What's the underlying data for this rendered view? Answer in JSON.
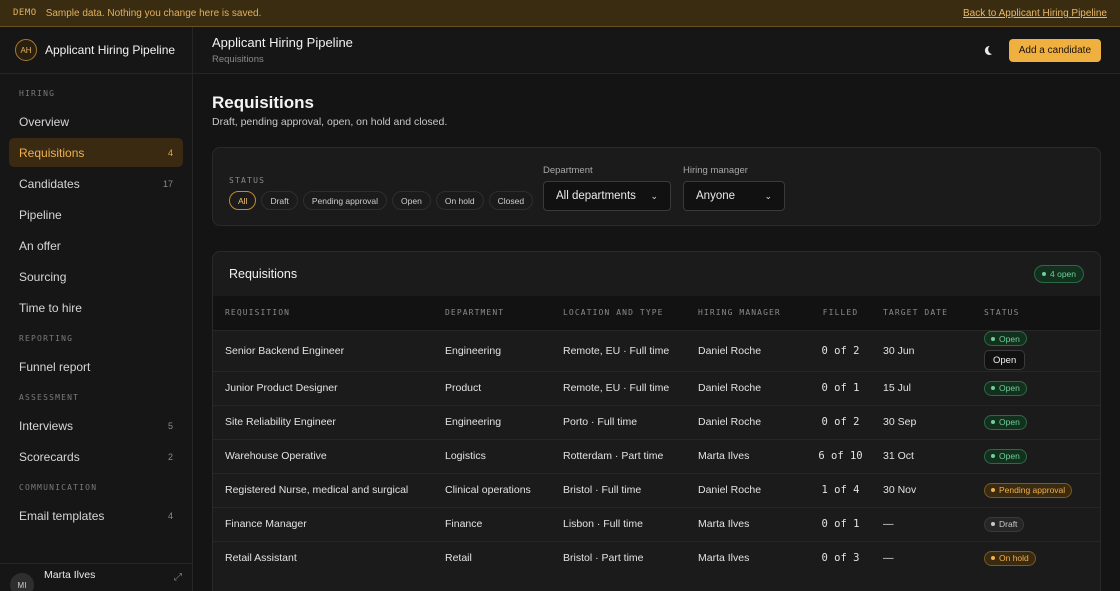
{
  "demo_banner": {
    "tag": "DEMO",
    "message": "Sample data. Nothing you change here is saved.",
    "link": "Back to Applicant Hiring Pipeline"
  },
  "brand": {
    "initials": "AH",
    "title": "Applicant Hiring Pipeline"
  },
  "sidebar": {
    "sections": [
      {
        "heading": "HIRING",
        "items": [
          {
            "label": "Overview",
            "count": ""
          },
          {
            "label": "Requisitions",
            "count": "4",
            "active": true
          },
          {
            "label": "Candidates",
            "count": "17"
          },
          {
            "label": "Pipeline",
            "count": ""
          },
          {
            "label": "An offer",
            "count": ""
          },
          {
            "label": "Sourcing",
            "count": ""
          },
          {
            "label": "Time to hire",
            "count": ""
          }
        ]
      },
      {
        "heading": "REPORTING",
        "items": [
          {
            "label": "Funnel report",
            "count": ""
          }
        ]
      },
      {
        "heading": "ASSESSMENT",
        "items": [
          {
            "label": "Interviews",
            "count": "5"
          },
          {
            "label": "Scorecards",
            "count": "2"
          }
        ]
      },
      {
        "heading": "COMMUNICATION",
        "items": [
          {
            "label": "Email templates",
            "count": "4"
          }
        ]
      }
    ],
    "user": {
      "initials": "MI",
      "name": "Marta Ilves"
    }
  },
  "topbar": {
    "title": "Applicant Hiring Pipeline",
    "breadcrumb": "Requisitions",
    "add_button": "Add a candidate"
  },
  "page": {
    "title": "Requisitions",
    "description": "Draft, pending approval, open, on hold and closed."
  },
  "filters": {
    "status_label": "STATUS",
    "chips": [
      "All",
      "Draft",
      "Pending approval",
      "Open",
      "On hold",
      "Closed"
    ],
    "active_chip": "All",
    "department_label": "Department",
    "department_value": "All departments",
    "manager_label": "Hiring manager",
    "manager_value": "Anyone"
  },
  "table": {
    "title": "Requisitions",
    "open_badge": "4 open",
    "headers": [
      "REQUISITION",
      "DEPARTMENT",
      "LOCATION AND TYPE",
      "HIRING MANAGER",
      "FILLED",
      "TARGET DATE",
      "STATUS"
    ],
    "rows": [
      {
        "requisition": "Senior Backend Engineer",
        "department": "Engineering",
        "location": "Remote, EU · Full time",
        "manager": "Daniel Roche",
        "filled": "0 of 2",
        "target": "30 Jun",
        "status": "Open",
        "status_kind": "open",
        "tooltip": "Open"
      },
      {
        "requisition": "Junior Product Designer",
        "department": "Product",
        "location": "Remote, EU · Full time",
        "manager": "Daniel Roche",
        "filled": "0 of 1",
        "target": "15 Jul",
        "status": "Open",
        "status_kind": "open"
      },
      {
        "requisition": "Site Reliability Engineer",
        "department": "Engineering",
        "location": "Porto · Full time",
        "manager": "Daniel Roche",
        "filled": "0 of 2",
        "target": "30 Sep",
        "status": "Open",
        "status_kind": "open"
      },
      {
        "requisition": "Warehouse Operative",
        "department": "Logistics",
        "location": "Rotterdam · Part time",
        "manager": "Marta Ilves",
        "filled": "6 of 10",
        "target": "31 Oct",
        "status": "Open",
        "status_kind": "open"
      },
      {
        "requisition": "Registered Nurse, medical and surgical",
        "department": "Clinical operations",
        "location": "Bristol · Full time",
        "manager": "Daniel Roche",
        "filled": "1 of 4",
        "target": "30 Nov",
        "status": "Pending approval",
        "status_kind": "pending"
      },
      {
        "requisition": "Finance Manager",
        "department": "Finance",
        "location": "Lisbon · Full time",
        "manager": "Marta Ilves",
        "filled": "0 of 1",
        "target": "—",
        "status": "Draft",
        "status_kind": "draft"
      },
      {
        "requisition": "Retail Assistant",
        "department": "Retail",
        "location": "Bristol · Part time",
        "manager": "Marta Ilves",
        "filled": "0 of 3",
        "target": "—",
        "status": "On hold",
        "status_kind": "hold"
      }
    ]
  }
}
